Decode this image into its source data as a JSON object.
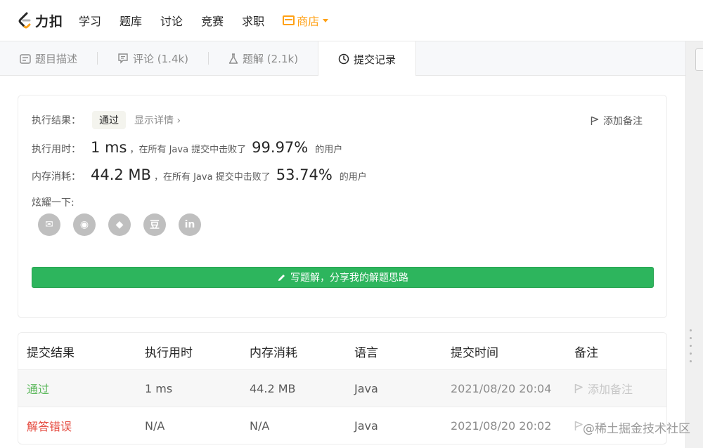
{
  "nav": {
    "logo_text": "力扣",
    "items": [
      "学习",
      "题库",
      "讨论",
      "竞赛",
      "求职"
    ],
    "store_label": "商店"
  },
  "tabs": [
    {
      "label": "题目描述",
      "icon": "description-icon"
    },
    {
      "label": "评论 (1.4k)",
      "icon": "comment-icon"
    },
    {
      "label": "题解 (2.1k)",
      "icon": "flask-icon"
    },
    {
      "label": "提交记录",
      "icon": "clock-icon",
      "active": true
    }
  ],
  "result": {
    "exec_result_label": "执行结果：",
    "status_badge": "通过",
    "details_link": "显示详情 ›",
    "add_note": "添加备注",
    "runtime_label": "执行用时：",
    "runtime_value": "1 ms",
    "runtime_mid": "，在所有 Java 提交中击败了",
    "runtime_pct": "99.97%",
    "runtime_suffix": "的用户",
    "memory_label": "内存消耗：",
    "memory_value": "44.2 MB",
    "memory_mid": "，在所有 Java 提交中击败了",
    "memory_pct": "53.74%",
    "memory_suffix": "的用户",
    "share_label": "炫耀一下:",
    "share_buttons": [
      {
        "icon": "wechat-icon",
        "glyph": "✉"
      },
      {
        "icon": "weibo-icon",
        "glyph": "◉"
      },
      {
        "icon": "qq-icon",
        "glyph": "◆"
      },
      {
        "icon": "douban-icon",
        "glyph": "豆"
      },
      {
        "icon": "linkedin-icon",
        "glyph": "in"
      }
    ],
    "write_solution": "写题解，分享我的解题思路"
  },
  "table": {
    "headers": [
      "提交结果",
      "执行用时",
      "内存消耗",
      "语言",
      "提交时间",
      "备注"
    ],
    "rows": [
      {
        "result": "通过",
        "runtime": "1 ms",
        "memory": "44.2 MB",
        "lang": "Java",
        "time": "2021/08/20 20:04",
        "note": "添加备注"
      },
      {
        "result": "解答错误",
        "runtime": "N/A",
        "memory": "N/A",
        "lang": "Java",
        "time": "2021/08/20 20:02",
        "note": ""
      }
    ]
  },
  "watermark": "@稀土掘金技术社区",
  "colors": {
    "accent": "#ffa116",
    "success": "#2db55d",
    "pass": "#5cb85c",
    "fail": "#e54d42"
  }
}
